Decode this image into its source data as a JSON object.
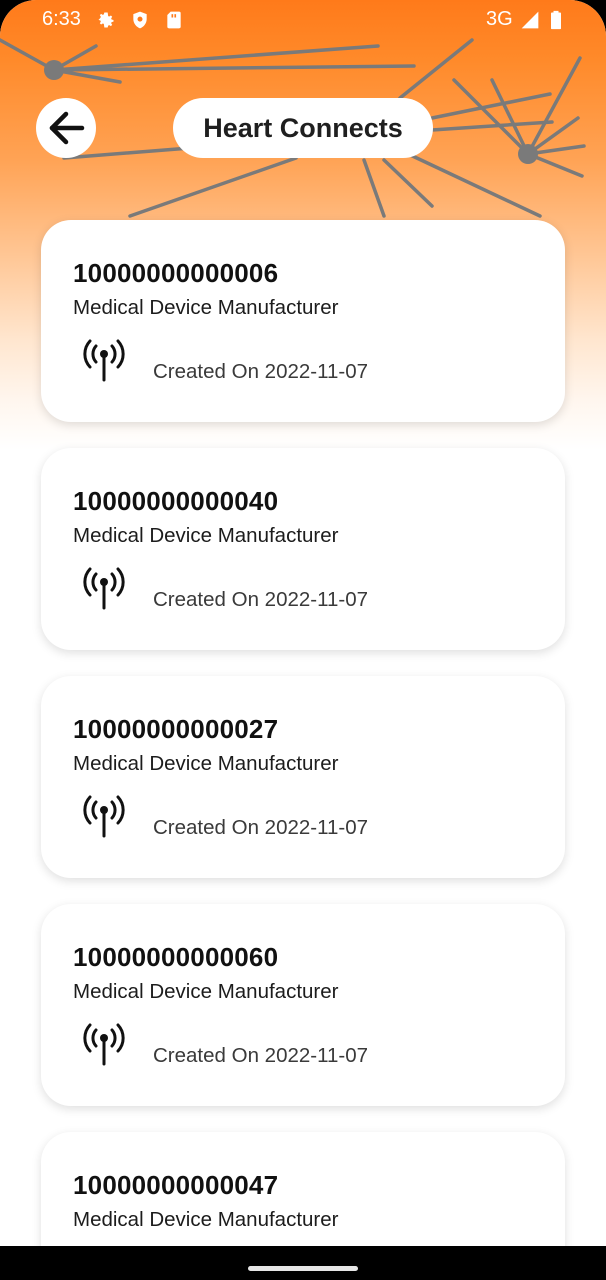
{
  "status_bar": {
    "time": "6:33",
    "network": "3G",
    "icons": [
      "settings-icon",
      "shield-icon",
      "sd-card-icon",
      "signal-icon",
      "battery-icon"
    ]
  },
  "header": {
    "title": "Heart Connects",
    "back_icon": "arrow-left-icon"
  },
  "devices": [
    {
      "id": "10000000000006",
      "type": "Medical Device Manufacturer",
      "created": "Created On 2022-11-07"
    },
    {
      "id": "10000000000040",
      "type": "Medical Device Manufacturer",
      "created": "Created On 2022-11-07"
    },
    {
      "id": "10000000000027",
      "type": "Medical Device Manufacturer",
      "created": "Created On 2022-11-07"
    },
    {
      "id": "10000000000060",
      "type": "Medical Device Manufacturer",
      "created": "Created On 2022-11-07"
    },
    {
      "id": "10000000000047",
      "type": "Medical Device Manufacturer",
      "created": ""
    }
  ],
  "colors": {
    "accent": "#ff7a1a",
    "card": "#ffffff",
    "network_lines": "#7a7a7a"
  }
}
